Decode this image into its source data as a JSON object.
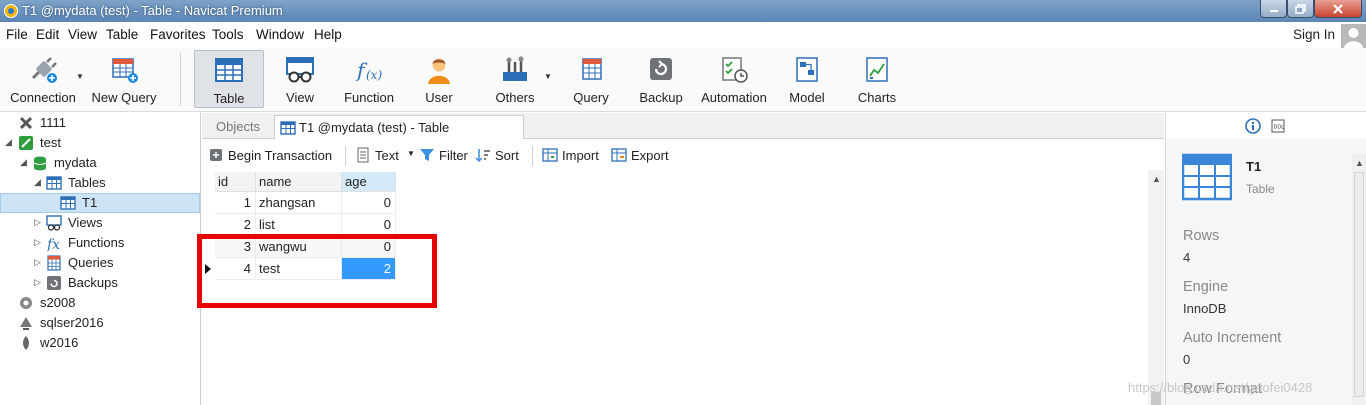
{
  "window": {
    "title": "T1 @mydata (test) - Table - Navicat Premium"
  },
  "menubar": {
    "items": [
      "File",
      "Edit",
      "View",
      "Table",
      "Favorites",
      "Tools",
      "Window",
      "Help"
    ],
    "sign_in": "Sign In"
  },
  "toolbar": {
    "buttons": [
      {
        "label": "Connection",
        "icon": "connection-plug-icon"
      },
      {
        "label": "New Query",
        "icon": "new-query-icon"
      },
      {
        "label": "Table",
        "icon": "table-grid-icon",
        "active": true
      },
      {
        "label": "View",
        "icon": "view-glasses-icon"
      },
      {
        "label": "Function",
        "icon": "function-fx-icon"
      },
      {
        "label": "User",
        "icon": "user-icon"
      },
      {
        "label": "Others",
        "icon": "others-tools-icon"
      },
      {
        "label": "Query",
        "icon": "query-icon"
      },
      {
        "label": "Backup",
        "icon": "backup-icon"
      },
      {
        "label": "Automation",
        "icon": "automation-icon"
      },
      {
        "label": "Model",
        "icon": "model-icon"
      },
      {
        "label": "Charts",
        "icon": "charts-icon"
      }
    ]
  },
  "navtree": {
    "nodes": [
      {
        "label": "1111",
        "icon": "connection-icon"
      },
      {
        "label": "test",
        "icon": "mysql-connection-icon"
      },
      {
        "label": "mydata",
        "icon": "database-icon"
      },
      {
        "label": "Tables",
        "icon": "tables-folder-icon"
      },
      {
        "label": "T1",
        "icon": "table-icon",
        "selected": true
      },
      {
        "label": "Views",
        "icon": "views-icon"
      },
      {
        "label": "Functions",
        "icon": "functions-icon"
      },
      {
        "label": "Queries",
        "icon": "queries-icon"
      },
      {
        "label": "Backups",
        "icon": "backups-icon"
      },
      {
        "label": "s2008",
        "icon": "sqlserver-connection-icon"
      },
      {
        "label": "sqlser2016",
        "icon": "sqlserver-connection-icon"
      },
      {
        "label": "w2016",
        "icon": "mongodb-connection-icon"
      }
    ]
  },
  "tabs": {
    "objects": "Objects",
    "current": "T1 @mydata (test) - Table"
  },
  "grid_toolbar": {
    "begin_transaction": "Begin Transaction",
    "text": "Text",
    "filter": "Filter",
    "sort": "Sort",
    "import": "Import",
    "export": "Export"
  },
  "grid": {
    "columns": [
      "id",
      "name",
      "age"
    ],
    "selected_column": "age",
    "rows": [
      {
        "id": "1",
        "name": "zhangsan",
        "age": "0"
      },
      {
        "id": "2",
        "name": "list",
        "age": "0"
      },
      {
        "id": "3",
        "name": "wangwu",
        "age": "0"
      },
      {
        "id": "4",
        "name": "test",
        "age": "2",
        "current": true
      }
    ]
  },
  "info": {
    "object_name": "T1",
    "object_type": "Table",
    "properties": [
      {
        "label": "Rows",
        "value": "4"
      },
      {
        "label": "Engine",
        "value": "InnoDB"
      },
      {
        "label": "Auto Increment",
        "value": "0"
      },
      {
        "label": "Row Format",
        "value": ""
      }
    ]
  },
  "watermark": "https://blog.csdn.net/gaofei0428",
  "colors": {
    "highlight_box": "#e60000",
    "selected_cell": "#3399ff",
    "titlebar": "#6a92c0"
  }
}
